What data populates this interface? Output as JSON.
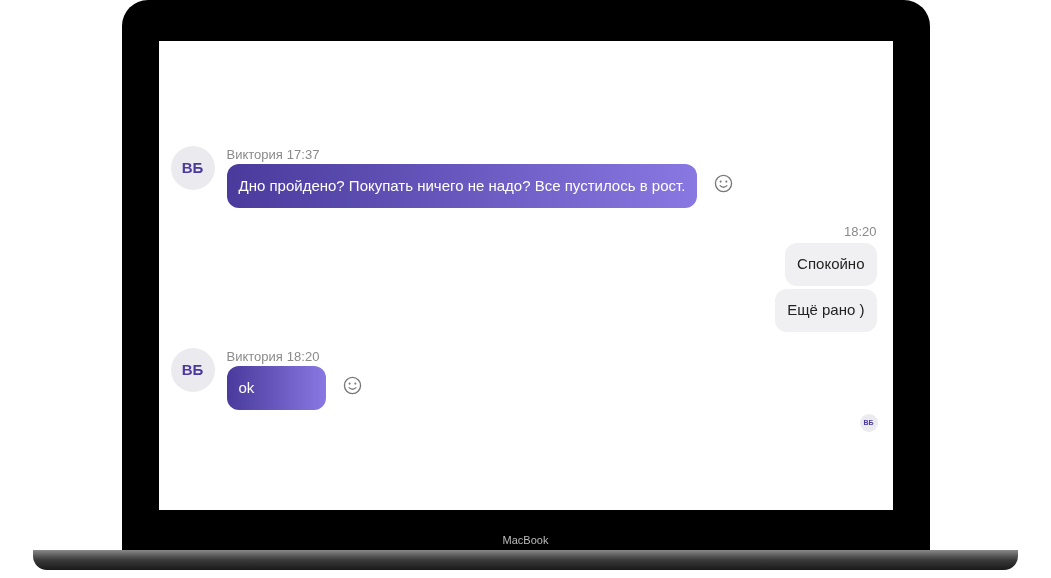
{
  "device": {
    "label": "MacBook"
  },
  "messages": [
    {
      "kind": "incoming",
      "avatar": "ВБ",
      "author": "Виктория",
      "time": "17:37",
      "bubbles": [
        "Дно пройдено?  Покупать ничего не надо?  Все пустилось в рост."
      ]
    },
    {
      "kind": "outgoing",
      "time": "18:20",
      "bubbles": [
        "Спокойно",
        "Ещё рано )"
      ]
    },
    {
      "kind": "incoming",
      "avatar": "ВБ",
      "author": "Виктория",
      "time": "18:20",
      "bubbles": [
        "ok"
      ]
    }
  ],
  "read_receipt": {
    "initials": "ВБ"
  }
}
